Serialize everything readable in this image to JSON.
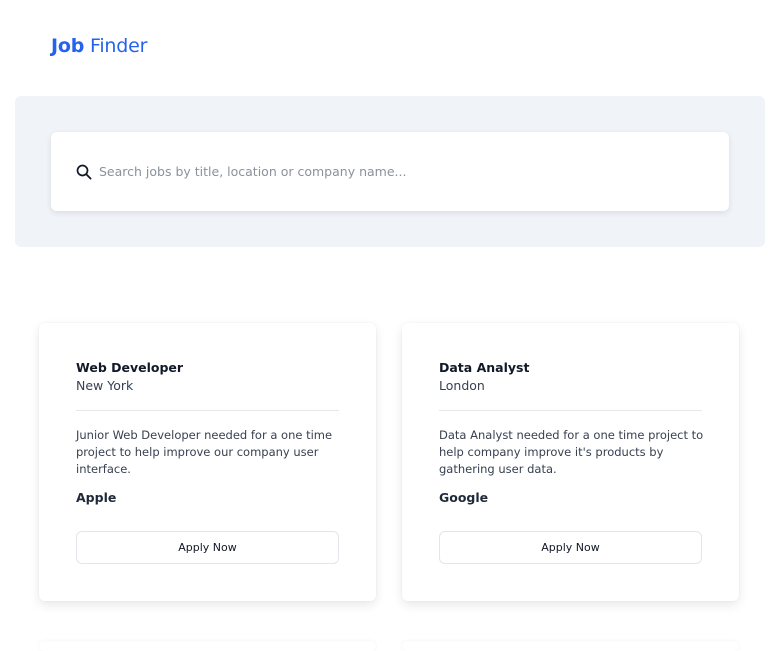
{
  "header": {
    "logo_bold": "Job",
    "logo_light": "Finder"
  },
  "search": {
    "placeholder": "Search jobs by title, location or company name...",
    "value": "",
    "icon": "search-icon"
  },
  "jobs": [
    {
      "title": "Web Developer",
      "location": "New York",
      "description": "Junior Web Developer needed for a one time project to help improve our company user interface.",
      "company": "Apple",
      "apply_label": "Apply Now"
    },
    {
      "title": "Data Analyst",
      "location": "London",
      "description": "Data Analyst needed for a one time project to help company improve it's products by gathering user data.",
      "company": "Google",
      "apply_label": "Apply Now"
    }
  ],
  "colors": {
    "brand": "#2563eb",
    "search_band": "#f0f3f8"
  }
}
